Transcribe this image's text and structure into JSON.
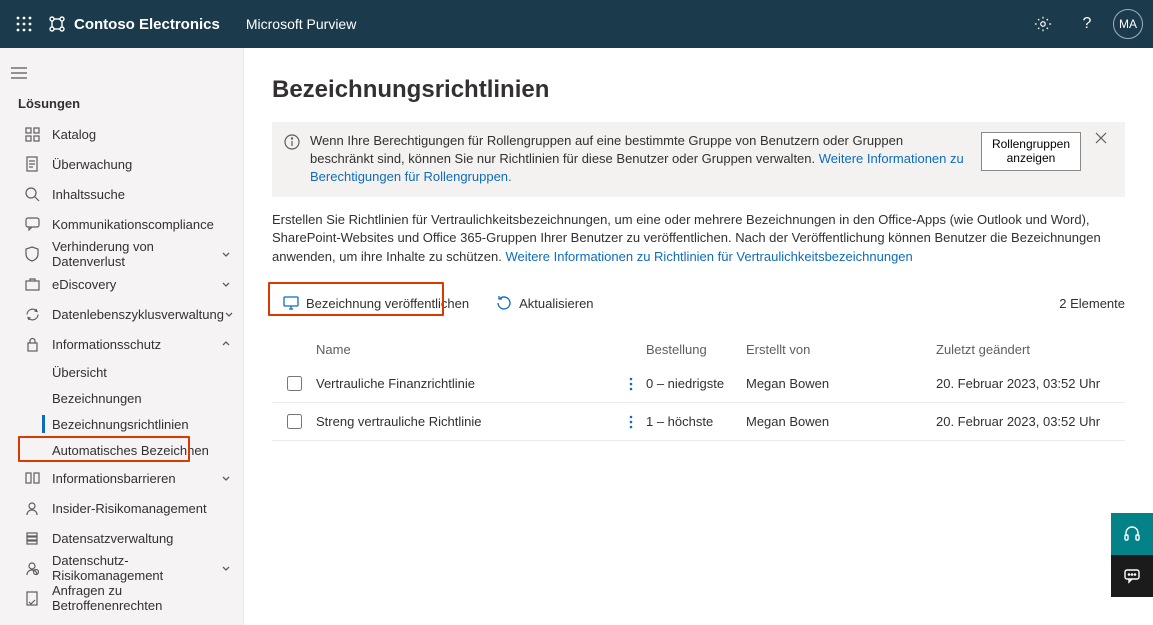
{
  "header": {
    "brand": "Contoso Electronics",
    "product": "Microsoft Purview",
    "avatar_initials": "MA"
  },
  "sidebar": {
    "section_title": "Lösungen",
    "items": [
      {
        "label": "Katalog",
        "icon": "grid"
      },
      {
        "label": "Überwachung",
        "icon": "doc"
      },
      {
        "label": "Inhaltssuche",
        "icon": "search"
      },
      {
        "label": "Kommunikationscompliance",
        "icon": "chat"
      },
      {
        "label": "Verhinderung von Datenverlust",
        "icon": "shield",
        "expandable": true
      },
      {
        "label": "eDiscovery",
        "icon": "briefcase",
        "expandable": true
      },
      {
        "label": "Datenlebenszyklusverwaltung",
        "icon": "cycle",
        "expandable": true
      },
      {
        "label": "Informationsschutz",
        "icon": "lock",
        "expandable": true,
        "expanded": true,
        "sub": [
          {
            "label": "Übersicht"
          },
          {
            "label": "Bezeichnungen"
          },
          {
            "label": "Bezeichnungsrichtlinien",
            "selected": true
          },
          {
            "label": "Automatisches Bezeichnen"
          }
        ]
      },
      {
        "label": "Informationsbarrieren",
        "icon": "barrier",
        "expandable": true
      },
      {
        "label": "Insider-Risikomanagement",
        "icon": "user"
      },
      {
        "label": "Datensatzverwaltung",
        "icon": "records"
      },
      {
        "label": "Datenschutz-Risikomanagement",
        "icon": "privacy",
        "expandable": true
      },
      {
        "label": "Anfragen zu Betroffenenrechten",
        "icon": "request"
      }
    ]
  },
  "main": {
    "title": "Bezeichnungsrichtlinien",
    "banner": {
      "text_before_link": "Wenn Ihre Berechtigungen für Rollengruppen auf eine bestimmte Gruppe von Benutzern oder Gruppen beschränkt sind, können Sie nur Richtlinien für diese Benutzer oder Gruppen verwalten. ",
      "link": "Weitere Informationen zu Berechtigungen für Rollengruppen.",
      "button_line1": "Rollengruppen",
      "button_line2": "anzeigen"
    },
    "description": {
      "text_before_link": "Erstellen Sie Richtlinien für Vertraulichkeitsbezeichnungen, um eine oder mehrere Bezeichnungen in den Office-Apps (wie Outlook und Word), SharePoint-Websites und Office 365-Gruppen Ihrer Benutzer zu veröffentlichen. Nach der Veröffentlichung können Benutzer die Bezeichnungen anwenden, um ihre Inhalte zu schützen. ",
      "link": "Weitere Informationen zu Richtlinien für Vertraulichkeitsbezeichnungen"
    },
    "toolbar": {
      "publish": "Bezeichnung veröffentlichen",
      "refresh": "Aktualisieren",
      "item_count": "2 Elemente"
    },
    "table": {
      "columns": {
        "name": "Name",
        "order": "Bestellung",
        "creator": "Erstellt von",
        "modified": "Zuletzt geändert"
      },
      "rows": [
        {
          "name": "Vertrauliche Finanzrichtlinie",
          "order": "0 – niedrigste",
          "creator": "Megan Bowen",
          "modified": "20. Februar 2023, 03:52 Uhr"
        },
        {
          "name": "Streng vertrauliche Richtlinie",
          "order": "1 – höchste",
          "creator": "Megan Bowen",
          "modified": "20. Februar 2023, 03:52 Uhr"
        }
      ]
    }
  }
}
